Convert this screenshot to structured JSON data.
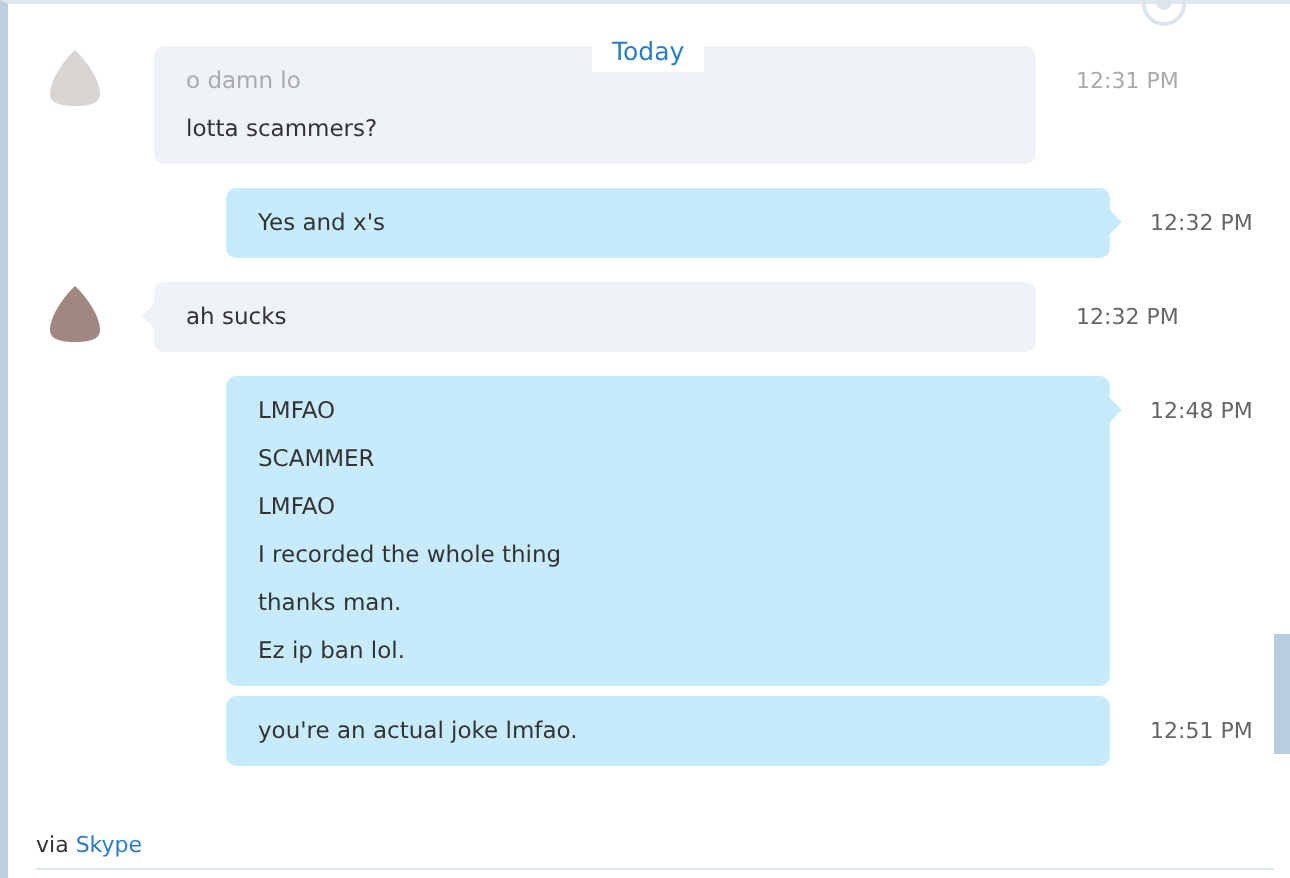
{
  "date_divider": "Today",
  "messages": [
    {
      "kind": "incoming",
      "obscured": true,
      "avatar": true,
      "tail": false,
      "lines": [
        {
          "text": "o damn lo",
          "faded": true
        },
        {
          "text": "lotta scammers?",
          "faded": false
        }
      ],
      "time": "12:31 PM"
    },
    {
      "kind": "outgoing",
      "obscured": false,
      "tail": true,
      "lines": [
        {
          "text": "Yes and x's",
          "faded": false
        }
      ],
      "time": "12:32 PM"
    },
    {
      "kind": "incoming",
      "obscured": false,
      "avatar": true,
      "tail": true,
      "lines": [
        {
          "text": "ah sucks",
          "faded": false
        }
      ],
      "time": "12:32 PM"
    },
    {
      "kind": "outgoing",
      "obscured": false,
      "tail": true,
      "lines": [
        {
          "text": "LMFAO",
          "faded": false
        },
        {
          "text": "SCAMMER",
          "faded": false
        },
        {
          "text": "LMFAO",
          "faded": false
        },
        {
          "text": "I recorded the whole thing",
          "faded": false
        },
        {
          "text": "thanks man.",
          "faded": false
        },
        {
          "text": "Ez ip ban lol.",
          "faded": false
        }
      ],
      "time": "12:48 PM"
    },
    {
      "kind": "outgoing",
      "obscured": false,
      "tail": false,
      "lines": [
        {
          "text": "you're an actual joke lmfao.",
          "faded": false
        }
      ],
      "time": "12:51 PM"
    }
  ],
  "footer": {
    "via": "via",
    "link": "Skype"
  }
}
